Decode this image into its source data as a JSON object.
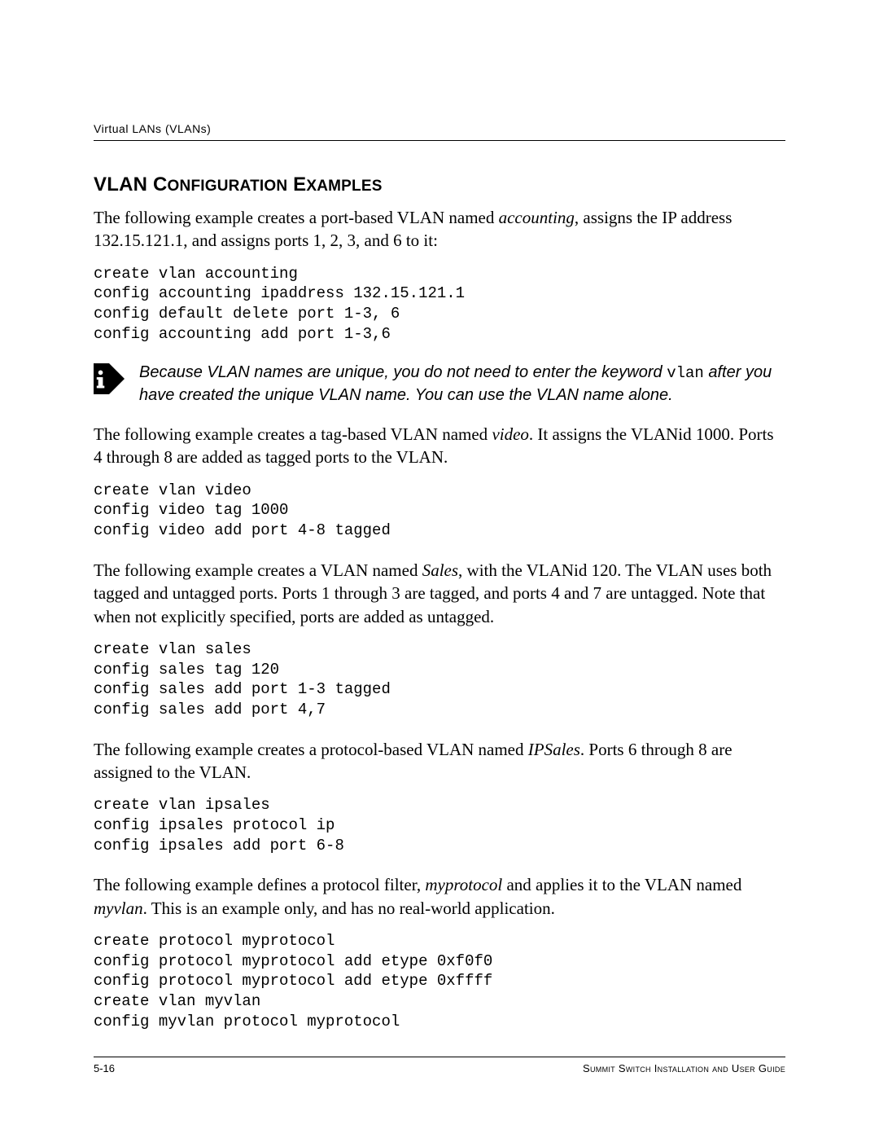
{
  "running_header": "Virtual LANs (VLANs)",
  "section_title": {
    "w1": "VLAN C",
    "w2": "ONFIGURATION",
    "w3": " E",
    "w4": "XAMPLES"
  },
  "para1": {
    "pre": "The following example creates a port-based VLAN named ",
    "em": "accounting",
    "post": ", assigns the IP address 132.15.121.1, and assigns ports 1, 2, 3, and 6 to it:"
  },
  "code1": "create vlan accounting\nconfig accounting ipaddress 132.15.121.1\nconfig default delete port 1-3, 6\nconfig accounting add port 1-3,6",
  "note": {
    "pre": "Because VLAN names are unique, you do not need to enter the keyword ",
    "kw": "vlan",
    "post": " after you have created the unique VLAN name. You can use the VLAN name alone."
  },
  "para2": {
    "pre": "The following example creates a tag-based VLAN named ",
    "em": "video",
    "post": ". It assigns the VLANid 1000. Ports 4 through 8 are added as tagged ports to the VLAN."
  },
  "code2": "create vlan video\nconfig video tag 1000\nconfig video add port 4-8 tagged",
  "para3": {
    "pre": "The following example creates a VLAN named ",
    "em": "Sales",
    "post": ", with the VLANid 120. The VLAN uses both tagged and untagged ports. Ports 1 through 3 are tagged, and ports 4 and 7 are untagged. Note that when not explicitly specified, ports are added as untagged."
  },
  "code3": "create vlan sales\nconfig sales tag 120\nconfig sales add port 1-3 tagged\nconfig sales add port 4,7",
  "para4": {
    "pre": "The following example creates a protocol-based VLAN named ",
    "em": "IPSales",
    "post": ". Ports 6 through 8 are assigned to the VLAN."
  },
  "code4": "create vlan ipsales\nconfig ipsales protocol ip\nconfig ipsales add port 6-8",
  "para5": {
    "pre": "The following example defines a protocol filter, ",
    "em1": "myprotocol",
    "mid": " and applies it to the VLAN named ",
    "em2": "myvlan",
    "post": ". This is an example only, and has no real-world application."
  },
  "code5": "create protocol myprotocol\nconfig protocol myprotocol add etype 0xf0f0\nconfig protocol myprotocol add etype 0xffff\ncreate vlan myvlan\nconfig myvlan protocol myprotocol",
  "footer": {
    "left": "5-16",
    "right": "Summit Switch Installation and User Guide"
  }
}
